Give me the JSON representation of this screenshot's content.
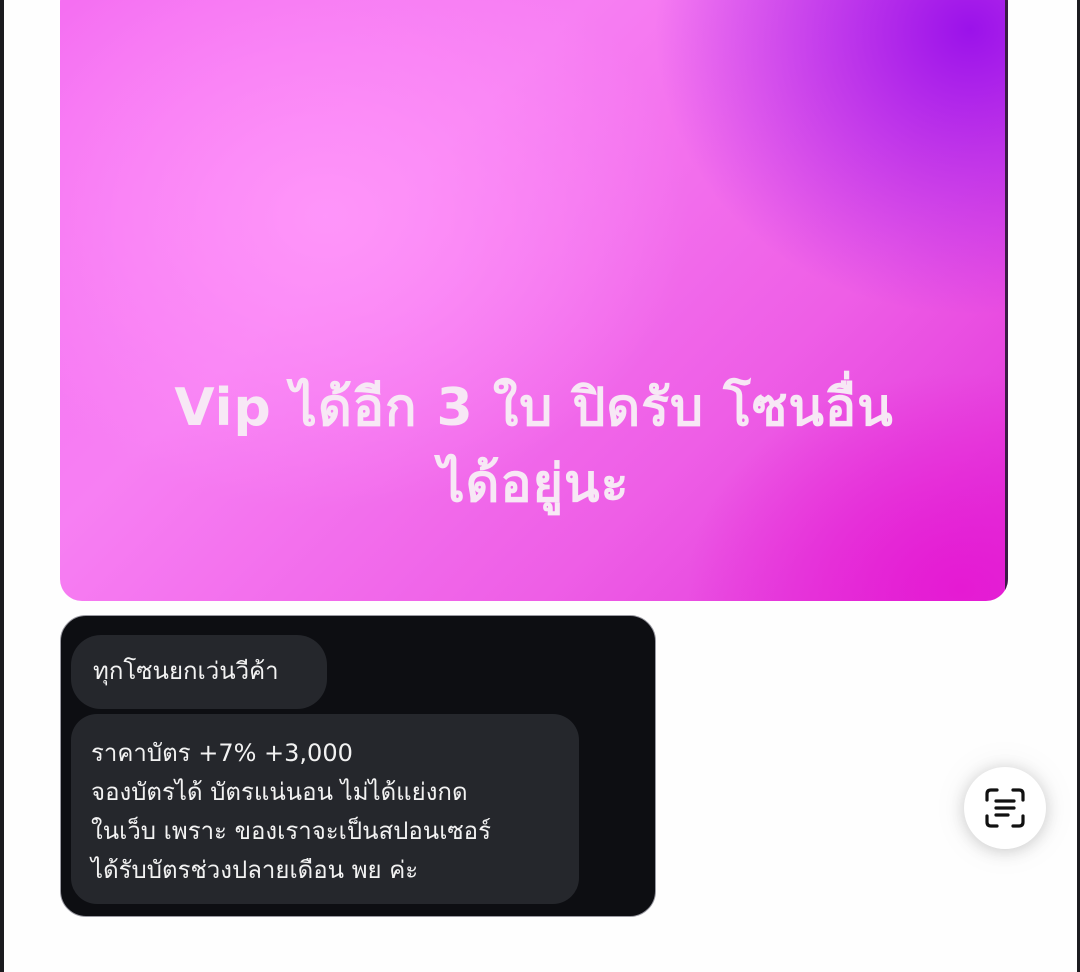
{
  "story": {
    "text_line1": "Vip ได้อีก 3 ใบ ปิดรับ โซนอื่น",
    "text_line2": "ได้อยู่นะ",
    "gradient_colors": [
      "#f77ff3",
      "#9b12ea",
      "#e51ad3"
    ]
  },
  "chat": {
    "messages": [
      {
        "text": "ทุกโซนยกเว่นวีค้า"
      },
      {
        "lines": [
          "ราคาบัตร +7% +3,000",
          "จองบัตรได้ บัตรแน่นอน ไม่ได้แย่งกด",
          "ในเว็บ เพราะ ของเราจะเป็นสปอนเซอร์",
          "ได้รับบัตรช่วงปลายเดือน พย ค่ะ"
        ]
      }
    ],
    "background": "#0d0e12",
    "bubble_color": "#25272c"
  },
  "controls": {
    "scan_button_icon": "text-scan-icon"
  }
}
